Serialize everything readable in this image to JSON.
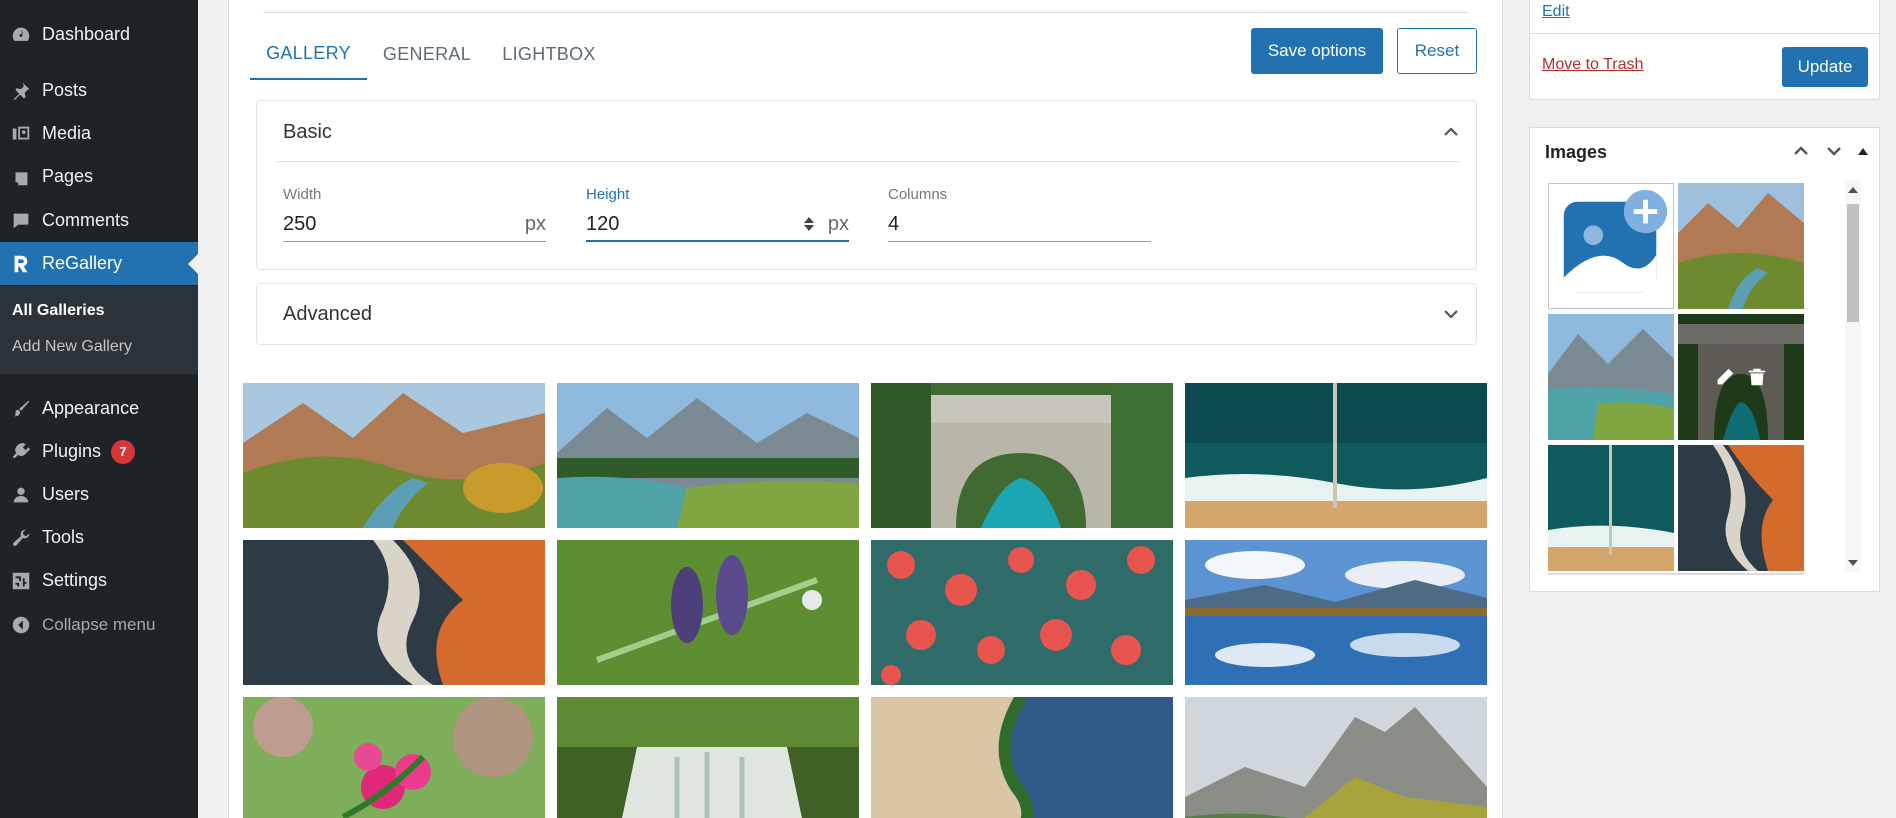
{
  "sidebar": {
    "items": [
      {
        "label": "Dashboard",
        "icon": "dashboard-icon"
      },
      {
        "label": "Posts",
        "icon": "pin-icon"
      },
      {
        "label": "Media",
        "icon": "media-icon"
      },
      {
        "label": "Pages",
        "icon": "pages-icon"
      },
      {
        "label": "Comments",
        "icon": "comment-icon"
      },
      {
        "label": "ReGallery",
        "icon": "regallery-icon",
        "active": true
      },
      {
        "label": "Appearance",
        "icon": "brush-icon"
      },
      {
        "label": "Plugins",
        "icon": "plugin-icon",
        "badge": "7"
      },
      {
        "label": "Users",
        "icon": "user-icon"
      },
      {
        "label": "Tools",
        "icon": "wrench-icon"
      },
      {
        "label": "Settings",
        "icon": "settings-icon"
      }
    ],
    "submenu": [
      {
        "label": "All Galleries",
        "current": true
      },
      {
        "label": "Add New Gallery"
      }
    ],
    "collapse_label": "Collapse menu"
  },
  "main": {
    "tabs": [
      {
        "label": "GALLERY",
        "active": true
      },
      {
        "label": "GENERAL"
      },
      {
        "label": "LIGHTBOX"
      }
    ],
    "save_label": "Save options",
    "reset_label": "Reset",
    "basic": {
      "title": "Basic",
      "fields": [
        {
          "label": "Width",
          "value": "250",
          "unit": "px"
        },
        {
          "label": "Height",
          "value": "120",
          "unit": "px"
        },
        {
          "label": "Columns",
          "value": "4"
        }
      ]
    },
    "advanced_title": "Advanced"
  },
  "publish": {
    "edit_label": "Edit",
    "trash_label": "Move to Trash",
    "update_label": "Update"
  },
  "images_box": {
    "title": "Images",
    "add_label": "Add images"
  },
  "colors": {
    "accent": "#2271b1",
    "sidebar_bg": "#1d2327",
    "badge": "#d63638"
  }
}
